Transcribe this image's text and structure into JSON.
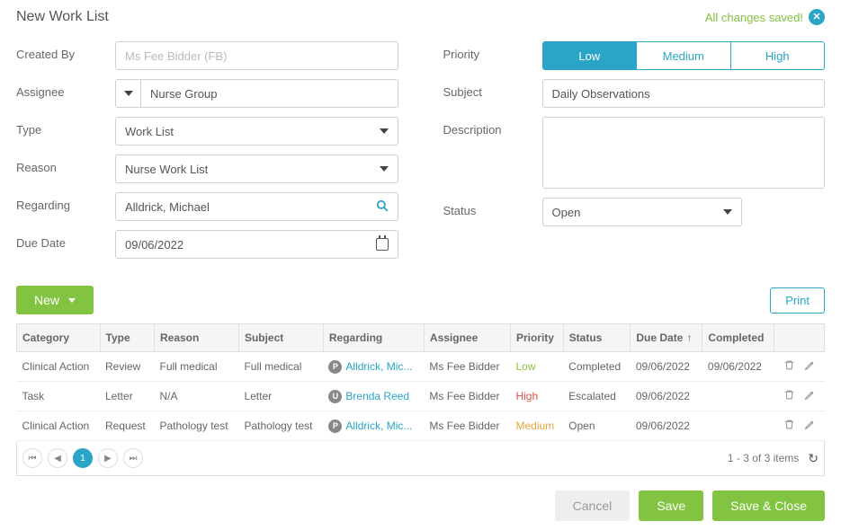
{
  "header": {
    "title": "New Work List",
    "saved_text": "All changes saved!"
  },
  "form": {
    "labels": {
      "created_by": "Created By",
      "assignee": "Assignee",
      "type": "Type",
      "reason": "Reason",
      "regarding": "Regarding",
      "due_date": "Due Date",
      "priority": "Priority",
      "subject": "Subject",
      "description": "Description",
      "status": "Status"
    },
    "created_by": "Ms Fee Bidder (FB)",
    "assignee": "Nurse Group",
    "type": "Work List",
    "reason": "Nurse Work List",
    "regarding": "Alldrick, Michael",
    "due_date": "09/06/2022",
    "priority": {
      "options": {
        "low": "Low",
        "medium": "Medium",
        "high": "High"
      },
      "selected": "Low"
    },
    "subject": "Daily Observations",
    "description": "",
    "status": "Open"
  },
  "list_actions": {
    "new": "New",
    "print": "Print"
  },
  "table": {
    "headers": {
      "category": "Category",
      "type": "Type",
      "reason": "Reason",
      "subject": "Subject",
      "regarding": "Regarding",
      "assignee": "Assignee",
      "priority": "Priority",
      "status": "Status",
      "due_date": "Due Date",
      "completed": "Completed"
    },
    "rows": [
      {
        "category": "Clinical Action",
        "type": "Review",
        "reason": "Full medical",
        "subject": "Full medical",
        "regarding": "Alldrick, Mic...",
        "regarding_badge": "P",
        "assignee": "Ms Fee Bidder",
        "priority": "Low",
        "priority_class": "prio-low",
        "status": "Completed",
        "due_date": "09/06/2022",
        "completed": "09/06/2022"
      },
      {
        "category": "Task",
        "type": "Letter",
        "reason": "N/A",
        "subject": "Letter",
        "regarding": "Brenda Reed",
        "regarding_badge": "U",
        "assignee": "Ms Fee Bidder",
        "priority": "High",
        "priority_class": "prio-high",
        "status": "Escalated",
        "due_date": "09/06/2022",
        "completed": ""
      },
      {
        "category": "Clinical Action",
        "type": "Request",
        "reason": "Pathology test",
        "subject": "Pathology test",
        "regarding": "Alldrick, Mic...",
        "regarding_badge": "P",
        "assignee": "Ms Fee Bidder",
        "priority": "Medium",
        "priority_class": "prio-med",
        "status": "Open",
        "due_date": "09/06/2022",
        "completed": ""
      }
    ]
  },
  "pager": {
    "current": "1",
    "info": "1 - 3 of 3 items"
  },
  "footer": {
    "cancel": "Cancel",
    "save": "Save",
    "save_close": "Save & Close"
  }
}
